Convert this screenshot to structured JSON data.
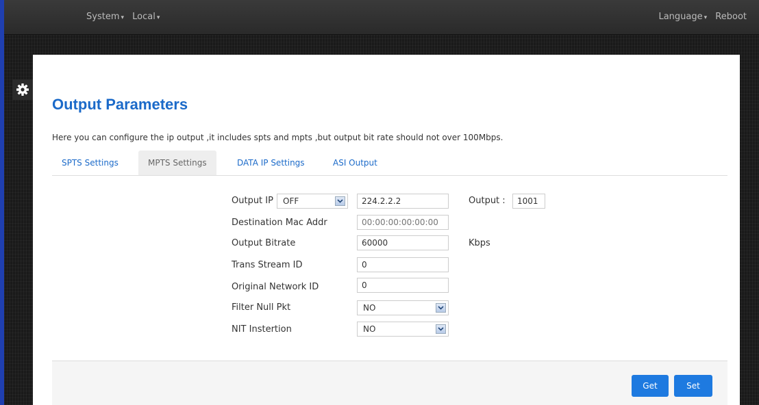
{
  "topnav": {
    "left": [
      {
        "label": "System"
      },
      {
        "label": "Local"
      }
    ],
    "right": [
      {
        "label": "Language"
      },
      {
        "label": "Reboot"
      }
    ]
  },
  "page": {
    "title": "Output Parameters",
    "description": "Here you can configure the ip output ,it includes spts and mpts ,but output bit rate should not over 100Mbps."
  },
  "tabs": [
    {
      "label": "SPTS Settings",
      "active": false
    },
    {
      "label": "MPTS Settings",
      "active": true
    },
    {
      "label": "DATA IP Settings",
      "active": false
    },
    {
      "label": "ASI Output",
      "active": false
    }
  ],
  "form": {
    "output_ip": {
      "label": "Output IP",
      "select": "OFF",
      "value": "224.2.2.2",
      "port_label": "Output :",
      "port_value": "1001"
    },
    "dest_mac": {
      "label": "Destination Mac Addr",
      "placeholder": "00:00:00:00:00:00"
    },
    "bitrate": {
      "label": "Output Bitrate",
      "value": "60000",
      "unit": "Kbps"
    },
    "ts_id": {
      "label": "Trans Stream ID",
      "value": "0"
    },
    "onid": {
      "label": "Original Network ID",
      "value": "0"
    },
    "filter_null": {
      "label": "Filter Null Pkt",
      "value": "NO"
    },
    "nit": {
      "label": "NIT Instertion",
      "value": "NO"
    }
  },
  "buttons": {
    "get": "Get",
    "set": "Set"
  }
}
